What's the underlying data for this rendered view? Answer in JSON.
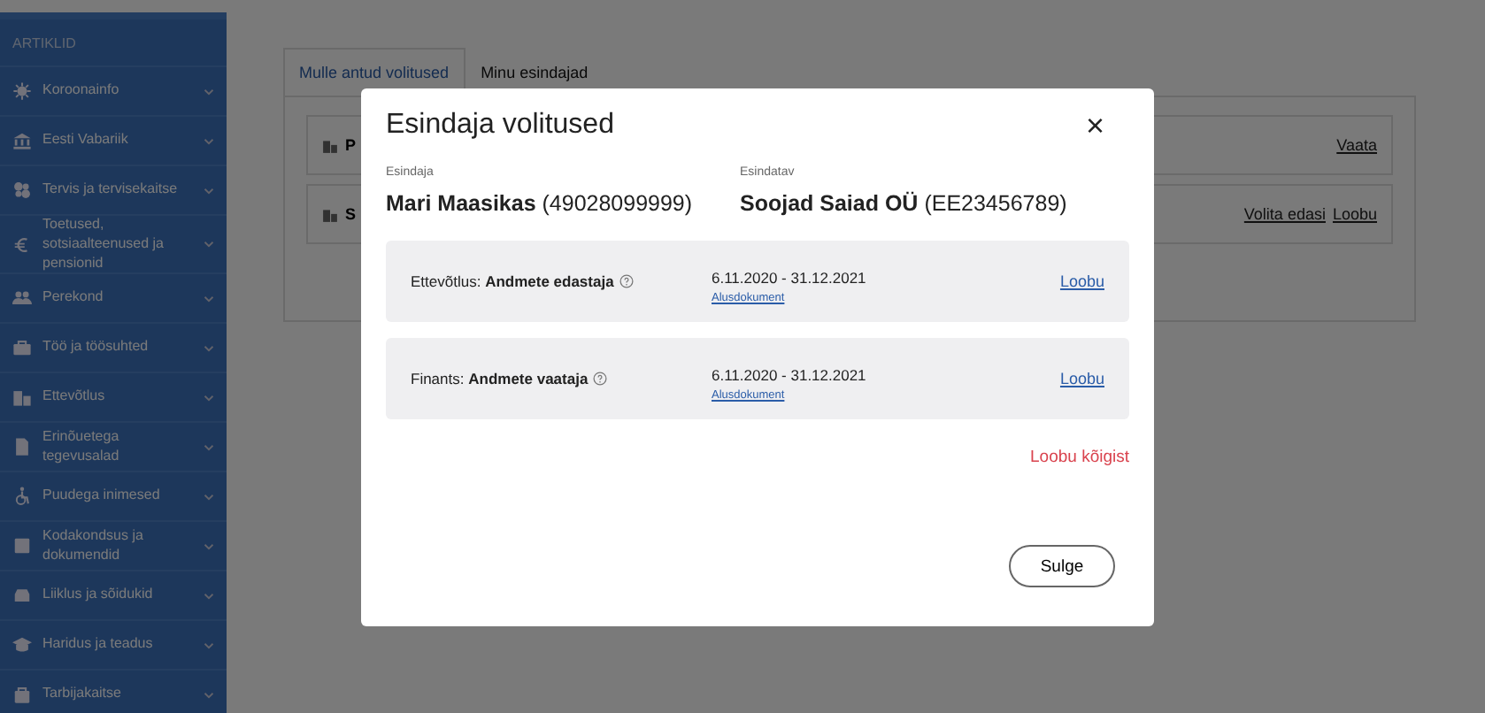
{
  "sidebar": {
    "heading": "ARTIKLID",
    "items": [
      {
        "label": "Koroonainfo"
      },
      {
        "label": "Eesti Vabariik"
      },
      {
        "label": "Tervis ja tervisekaitse"
      },
      {
        "label": "Toetused, sotsiaalteenused ja pensionid"
      },
      {
        "label": "Perekond"
      },
      {
        "label": "Töö ja töösuhted"
      },
      {
        "label": "Ettevõtlus"
      },
      {
        "label": "Erinõuetega tegevusalad"
      },
      {
        "label": "Puudega inimesed"
      },
      {
        "label": "Kodakondsus ja dokumendid"
      },
      {
        "label": "Liiklus ja sõidukid"
      },
      {
        "label": "Haridus ja teadus"
      },
      {
        "label": "Tarbijakaitse"
      }
    ]
  },
  "tabs": [
    {
      "label": "Mulle antud volitused",
      "selected": true
    },
    {
      "label": "Minu esindajad",
      "selected": false
    }
  ],
  "cards": [
    {
      "title": "P",
      "links": [
        "Vaata"
      ]
    },
    {
      "title": "S",
      "links": [
        "Volita edasi",
        "Loobu"
      ]
    }
  ],
  "modal": {
    "title": "Esindaja volitused",
    "close": "×",
    "representative": {
      "label": "Esindaja",
      "name": "Mari Maasikas",
      "code": "(49028099999)"
    },
    "represented": {
      "label": "Esindatav",
      "name": "Soojad Saiad OÜ",
      "code": "(EE23456789)"
    },
    "rights": [
      {
        "area": "Ettevõtlus:",
        "role": "Andmete edastaja",
        "period": "6.11.2020 - 31.12.2021",
        "document": "Alusdokument",
        "action": "Loobu"
      },
      {
        "area": "Finants:",
        "role": "Andmete vaataja",
        "period": "6.11.2020 - 31.12.2021",
        "document": "Alusdokument",
        "action": "Loobu"
      }
    ],
    "cancel_all": "Loobu kõigist",
    "close_button": "Sulge"
  }
}
